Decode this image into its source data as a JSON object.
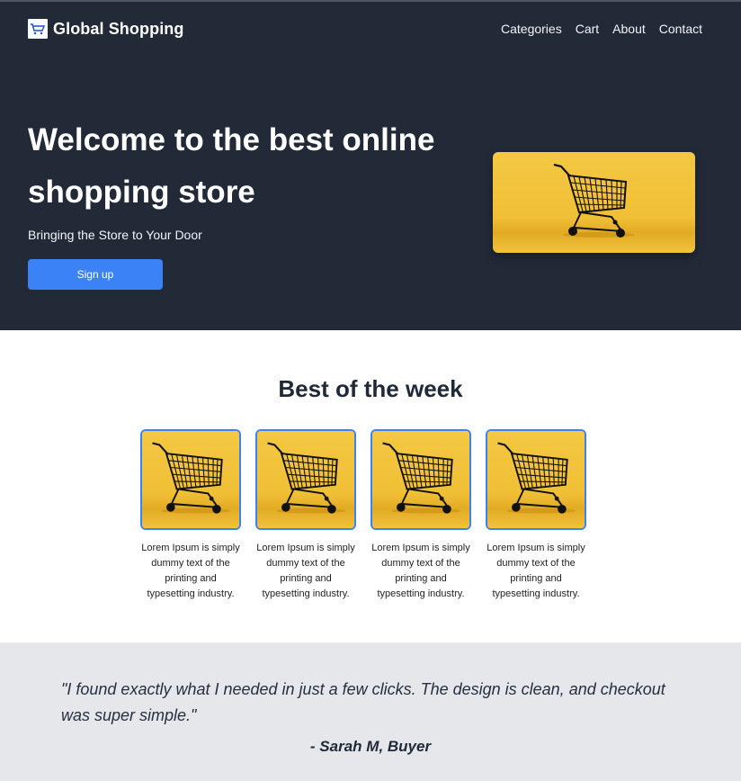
{
  "header": {
    "brand": "Global Shopping",
    "logo_text": "Global Shopping",
    "nav": [
      "Categories",
      "Cart",
      "About",
      "Contact"
    ]
  },
  "hero": {
    "title": "Welcome to the best online shopping store",
    "subtitle": "Bringing the Store to Your Door",
    "cta_label": "Sign up"
  },
  "best": {
    "title": "Best of the week",
    "products": [
      {
        "description": "Lorem Ipsum is simply dummy text of the printing and typesetting industry."
      },
      {
        "description": "Lorem Ipsum is simply dummy text of the printing and typesetting industry."
      },
      {
        "description": "Lorem Ipsum is simply dummy text of the printing and typesetting industry."
      },
      {
        "description": "Lorem Ipsum is simply dummy text of the printing and typesetting industry."
      }
    ]
  },
  "testimonial": {
    "quote": "\"I found exactly what I needed in just a few clicks. The design is clean, and checkout was super simple.\"",
    "author": "- Sarah M, Buyer"
  },
  "colors": {
    "hero_bg": "#222a38",
    "accent": "#3b82f6",
    "image_yellow": "#f2c13a",
    "testimonial_bg": "#e5e7eb"
  },
  "icons": [
    "shopping-cart-logo-icon",
    "shopping-cart-image"
  ]
}
